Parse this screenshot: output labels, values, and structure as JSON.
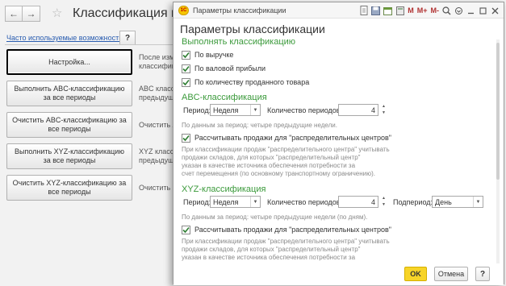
{
  "background": {
    "back_arrow": "←",
    "forward_arrow": "→",
    "star_glyph": "☆",
    "title": "Классификация номен",
    "freq_link": "Часто используемые возможности",
    "help_label": "?",
    "buttons": [
      {
        "label": "Настройка...",
        "desc_1": "После изме",
        "desc_2": "классификаци"
      },
      {
        "label": "Выполнить ABC-классификацию за все периоды",
        "desc_1": "ABC класс",
        "desc_2": "предыдущ"
      },
      {
        "label": "Очистить ABC-классификацию за все периоды",
        "desc_1": "Очистить A",
        "desc_2": ""
      },
      {
        "label": "Выполнить XYZ-классификацию за все периоды",
        "desc_1": "XYZ класс",
        "desc_2": "предыдущ"
      },
      {
        "label": "Очистить XYZ-классификацию за все периоды",
        "desc_1": "Очистить X",
        "desc_2": ""
      }
    ]
  },
  "dialog": {
    "window_title": "Параметры классификации",
    "logo_text": "1С",
    "toolbar": {
      "m": "M",
      "m_plus": "M+",
      "m_minus": "M-"
    },
    "heading": "Параметры классификации",
    "classify_section": {
      "title": "Выполнять классификацию",
      "options": [
        {
          "label": "По выручке",
          "checked": true
        },
        {
          "label": "По валовой прибыли",
          "checked": true
        },
        {
          "label": "По количеству проданного товара",
          "checked": true
        }
      ]
    },
    "abc": {
      "title": "ABC-классификация",
      "period_label": "Период:",
      "period_value": "Неделя",
      "count_label": "Количество периодов:",
      "count_value": "4",
      "hint": "По данным за период: четыре предыдущие недели.",
      "dc_label": "Рассчитывать продажи для \"распределительных центров\"",
      "dc_checked": true,
      "dc_hint": [
        "При классификации продаж \"распределительного центра\" учитывать",
        "продажи складов, для которых \"распределительный центр\"",
        "указан в качестве источника обеспечения потребности за",
        "счет перемещения (по основному транспортному ограничению)."
      ]
    },
    "xyz": {
      "title": "XYZ-классификация",
      "period_label": "Период:",
      "period_value": "Неделя",
      "count_label": "Количество периодов:",
      "count_value": "4",
      "subperiod_label": "Подпериод:",
      "subperiod_value": "День",
      "hint": "По данным за период: четыре предыдущие недели (по дням).",
      "dc_label": "Рассчитывать продажи для \"распределительных центров\"",
      "dc_checked": true,
      "dc_hint": [
        "При классификации продаж \"распределительного центра\" учитывать",
        "продажи складов, для которых \"распределительный центр\"",
        "указан в качестве источника обеспечения потребности за"
      ]
    },
    "footer": {
      "ok": "OK",
      "cancel": "Отмена",
      "help": "?"
    }
  }
}
